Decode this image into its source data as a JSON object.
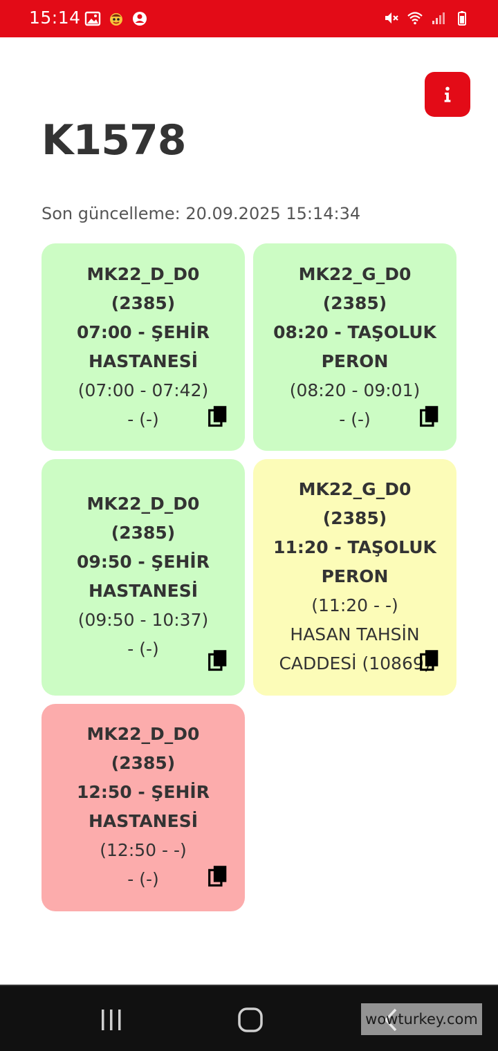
{
  "status_bar": {
    "time": "15:14",
    "left_icons": [
      "image-icon",
      "app-icon",
      "account-icon"
    ],
    "right_icons": [
      "mute-icon",
      "wifi-icon",
      "signal-icon",
      "battery-icon"
    ],
    "background": "#e30b17"
  },
  "header": {
    "title": "K1578",
    "info_icon": "info-icon",
    "last_update": "Son güncelleme: 20.09.2025 15:14:34"
  },
  "trips": [
    {
      "route": "MK22_D_D0",
      "code": "(2385)",
      "departure_line1": "07:00 - ŞEHİR",
      "departure_line2": "HASTANESİ",
      "time_range": "(07:00 - 07:42)",
      "location_line1": "- (-)",
      "location_line2": "",
      "status": "green"
    },
    {
      "route": "MK22_G_D0",
      "code": "(2385)",
      "departure_line1": "08:20 - TAŞOLUK",
      "departure_line2": "PERON",
      "time_range": "(08:20 - 09:01)",
      "location_line1": "- (-)",
      "location_line2": "",
      "status": "green"
    },
    {
      "route": "MK22_D_D0",
      "code": "(2385)",
      "departure_line1": "09:50 - ŞEHİR",
      "departure_line2": "HASTANESİ",
      "time_range": "(09:50 - 10:37)",
      "location_line1": "- (-)",
      "location_line2": "",
      "status": "green"
    },
    {
      "route": "MK22_G_D0",
      "code": "(2385)",
      "departure_line1": "11:20 - TAŞOLUK",
      "departure_line2": "PERON",
      "time_range": "(11:20 - -)",
      "location_line1": "HASAN TAHSİN",
      "location_line2": "CADDESİ (10869)",
      "status": "yellow"
    },
    {
      "route": "MK22_D_D0",
      "code": "(2385)",
      "departure_line1": "12:50 - ŞEHİR",
      "departure_line2": "HASTANESİ",
      "time_range": "(12:50 - -)",
      "location_line1": "- (-)",
      "location_line2": "",
      "status": "red"
    }
  ],
  "colors": {
    "accent": "#e30b17",
    "green": "#ccfcc4",
    "yellow": "#fcfcb8",
    "red": "#fcacac"
  },
  "nav_bar": {
    "buttons": [
      "recent-apps-icon",
      "home-icon",
      "back-icon"
    ]
  },
  "watermark": "wowturkey.com"
}
